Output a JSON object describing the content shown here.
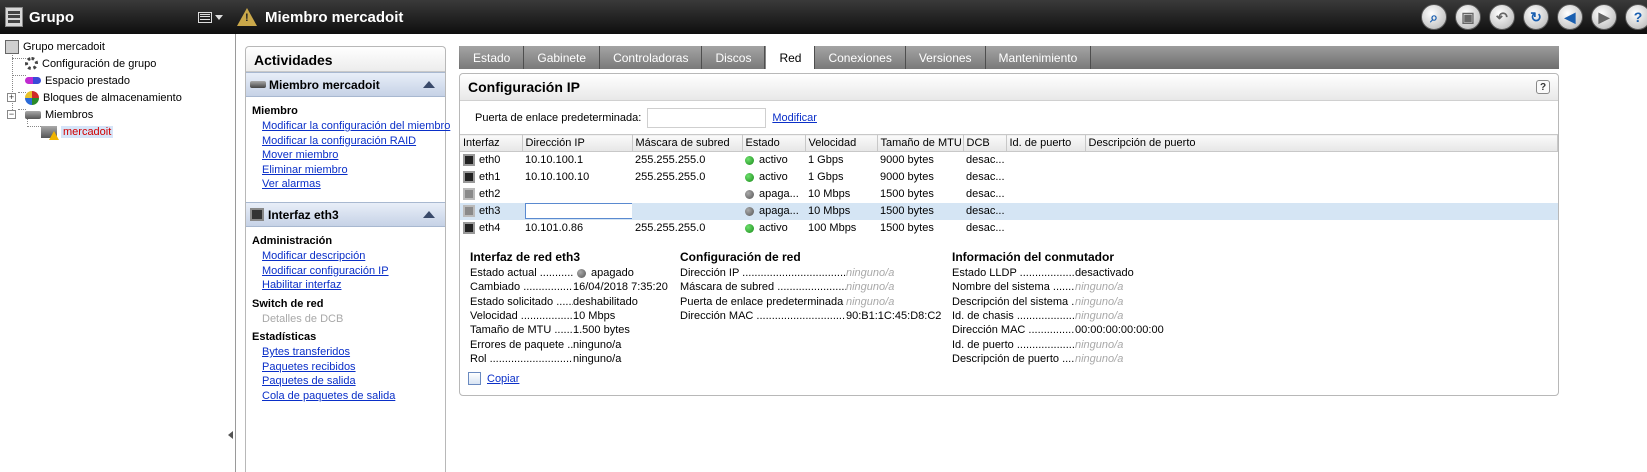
{
  "left": {
    "title": "Grupo",
    "tree": [
      {
        "label": "Grupo mercadoit"
      },
      {
        "label": "Configuración de grupo"
      },
      {
        "label": "Espacio prestado"
      },
      {
        "label": "Bloques de almacenamiento"
      },
      {
        "label": "Miembros"
      },
      {
        "label": "mercadoit"
      }
    ]
  },
  "header": {
    "title": "Miembro mercadoit"
  },
  "activities": {
    "title": "Actividades",
    "member_section": {
      "title": "Miembro mercadoit",
      "heading": "Miembro",
      "links": [
        "Modificar la configuración del miembro",
        "Modificar la configuración RAID",
        "Mover miembro",
        "Eliminar miembro",
        "Ver alarmas"
      ]
    },
    "iface_section": {
      "title": "Interfaz eth3",
      "admin_heading": "Administración",
      "admin_links": [
        "Modificar descripción",
        "Modificar configuración IP",
        "Habilitar interfaz"
      ],
      "switch_heading": "Switch de red",
      "switch_disabled": "Detalles de DCB",
      "stats_heading": "Estadísticas",
      "stats_links": [
        "Bytes transferidos",
        "Paquetes recibidos",
        "Paquetes de salida",
        "Cola de paquetes de salida"
      ]
    }
  },
  "tabs": [
    {
      "label": "Estado"
    },
    {
      "label": "Gabinete"
    },
    {
      "label": "Controladoras"
    },
    {
      "label": "Discos"
    },
    {
      "label": "Red",
      "active": true
    },
    {
      "label": "Conexiones"
    },
    {
      "label": "Versiones"
    },
    {
      "label": "Mantenimiento"
    }
  ],
  "ipconfig": {
    "title": "Configuración IP",
    "gateway_label": "Puerta de enlace predeterminada:",
    "gateway_value": "",
    "modify_label": "Modificar",
    "columns": [
      "Interfaz",
      "Dirección IP",
      "Máscara de subred",
      "Estado",
      "Velocidad",
      "Tamaño de MTU",
      "DCB",
      "Id. de puerto",
      "Descripción de puerto"
    ],
    "rows": [
      {
        "iface": "eth0",
        "ip": "10.10.100.1",
        "mask": "255.255.255.0",
        "status": "activo",
        "up": true,
        "speed": "1 Gbps",
        "mtu": "9000 bytes",
        "dcb": "desac...",
        "port": "",
        "desc": ""
      },
      {
        "iface": "eth1",
        "ip": "10.10.100.10",
        "mask": "255.255.255.0",
        "status": "activo",
        "up": true,
        "speed": "1 Gbps",
        "mtu": "9000 bytes",
        "dcb": "desac...",
        "port": "",
        "desc": ""
      },
      {
        "iface": "eth2",
        "ip": "",
        "mask": "",
        "status": "apaga...",
        "up": false,
        "speed": "10 Mbps",
        "mtu": "1500 bytes",
        "dcb": "desac...",
        "port": "",
        "desc": ""
      },
      {
        "iface": "eth3",
        "ip": "",
        "mask": "",
        "status": "apaga...",
        "up": false,
        "speed": "10 Mbps",
        "mtu": "1500 bytes",
        "dcb": "desac...",
        "port": "",
        "desc": "",
        "selected": true
      },
      {
        "iface": "eth4",
        "ip": "10.101.0.86",
        "mask": "255.255.255.0",
        "status": "activo",
        "up": true,
        "speed": "100 Mbps",
        "mtu": "1500 bytes",
        "dcb": "desac...",
        "port": "",
        "desc": ""
      }
    ]
  },
  "details": {
    "iface": {
      "title": "Interfaz de red eth3",
      "rows": [
        {
          "key": "Estado actual",
          "value": "apagado",
          "dot": true
        },
        {
          "key": "Cambiado",
          "value": "16/04/2018 7:35:20"
        },
        {
          "key": "Estado solicitado",
          "value": "deshabilitado"
        },
        {
          "key": "Velocidad",
          "value": "10 Mbps"
        },
        {
          "key": "Tamaño de MTU",
          "value": "1.500 bytes"
        },
        {
          "key": "Errores de paquete",
          "value": "ninguno/a"
        },
        {
          "key": "Rol",
          "value": "ninguno/a"
        }
      ]
    },
    "net": {
      "title": "Configuración de red",
      "rows": [
        {
          "key": "Dirección IP",
          "value": "ninguno/a",
          "muted": true
        },
        {
          "key": "Máscara de subred",
          "value": "ninguno/a",
          "muted": true
        },
        {
          "key": "Puerta de enlace predeterminada",
          "value": "ninguno/a",
          "muted": true
        },
        {
          "key": "Dirección MAC",
          "value": "90:B1:1C:45:D8:C2"
        }
      ]
    },
    "switch": {
      "title": "Información del conmutador",
      "rows": [
        {
          "key": "Estado LLDP",
          "value": "desactivado"
        },
        {
          "key": "Nombre del sistema",
          "value": "ninguno/a",
          "muted": true
        },
        {
          "key": "Descripción del sistema",
          "value": "ninguno/a",
          "muted": true
        },
        {
          "key": "Id. de chasis",
          "value": "ninguno/a",
          "muted": true
        },
        {
          "key": "Dirección MAC",
          "value": "00:00:00:00:00:00"
        },
        {
          "key": "Id. de puerto",
          "value": "ninguno/a",
          "muted": true
        },
        {
          "key": "Descripción de puerto",
          "value": "ninguno/a",
          "muted": true
        }
      ]
    },
    "copy_label": "Copiar"
  }
}
